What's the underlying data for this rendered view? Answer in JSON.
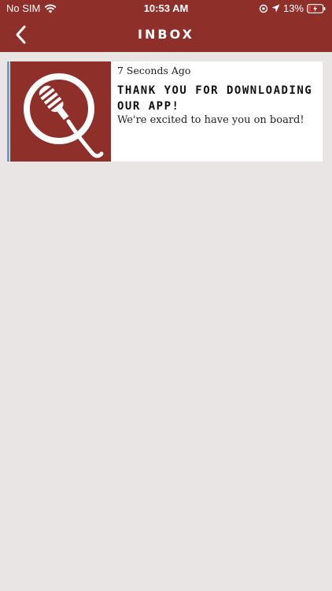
{
  "statusbar": {
    "carrier": "No SIM",
    "time": "10:53 AM",
    "battery": "13%"
  },
  "navbar": {
    "title": "INBOX"
  },
  "messages": [
    {
      "time": "7 Seconds Ago",
      "title": "THANK YOU FOR DOWNLOADING OUR APP!",
      "body": "We're excited to have you on board!"
    }
  ],
  "colors": {
    "brand": "#8f2f2a",
    "background": "#e9e5e4",
    "unread_indicator": "#6d9be0"
  }
}
